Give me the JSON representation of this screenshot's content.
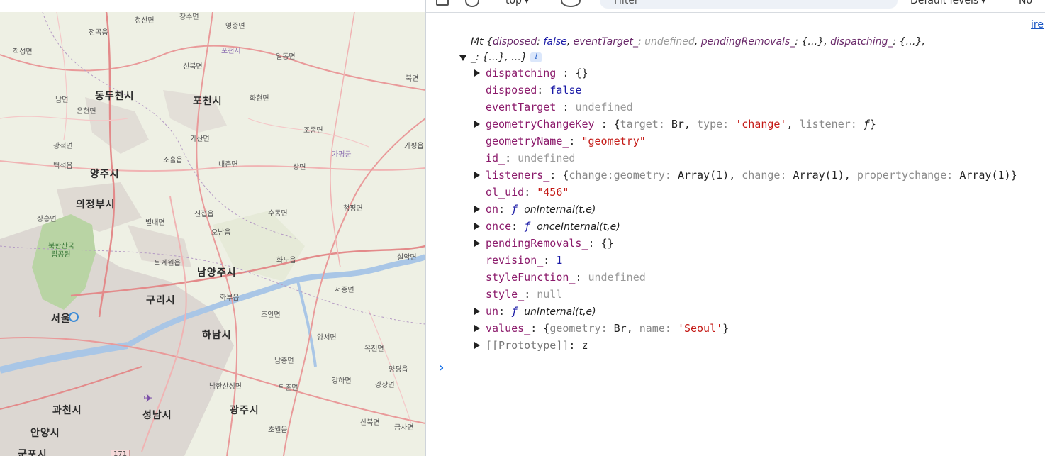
{
  "toolbar": {
    "context": "top",
    "filter_placeholder": "Filter",
    "levels": "Default levels",
    "issues": "No",
    "icons": [
      "sidebar-icon",
      "clear-console-icon",
      "eye-icon",
      "dropdown-chevron-icon"
    ]
  },
  "source_link": "ire",
  "map": {
    "marker_color": "#3b8ad6",
    "places_large": [
      "동두천시",
      "포천시",
      "양주시",
      "의정부시",
      "남양주시",
      "구리시",
      "서울",
      "하남시",
      "성남시",
      "광주시",
      "과천시",
      "안양시",
      "군포시"
    ],
    "places_mid": [
      "가평군",
      "북한산국립공원"
    ],
    "places_small": [
      "청산면",
      "창수면",
      "영중면",
      "전곡읍",
      "적성면",
      "포천시",
      "일동면",
      "신북면",
      "북면",
      "남면",
      "화현면",
      "은현면",
      "조종면",
      "광적면",
      "가산면",
      "가평읍",
      "소흘읍",
      "내촌면",
      "백석읍",
      "상면",
      "장흥면",
      "진접읍",
      "청평면",
      "별내면",
      "오남읍",
      "수동면",
      "퇴계원읍",
      "화도읍",
      "설악면",
      "서종면",
      "화부읍",
      "조안면",
      "양서면",
      "옥천면",
      "남종면",
      "양평읍",
      "남한산성면",
      "퇴촌면",
      "강하면",
      "강상면",
      "초월읍",
      "산북면",
      "금사면"
    ],
    "park_lines": [
      "북한산국",
      "립공원"
    ],
    "road_shield": "171",
    "icons": [
      "airport-icon"
    ]
  },
  "console": {
    "summary": {
      "class_name": "Mt",
      "line1_items": [
        {
          "key": "disposed",
          "value": "false",
          "kind": "bool"
        },
        {
          "key": "eventTarget_",
          "value": "undefined",
          "kind": "undef"
        },
        {
          "key": "pendingRemovals_",
          "value": "{…}",
          "kind": "plain"
        },
        {
          "key": "dispatching_",
          "value": "{…}",
          "kind": "plain"
        }
      ],
      "line2_text": "_: {…}, …}"
    },
    "properties": [
      {
        "key": "dispatching_",
        "value": "{}",
        "expandable": true
      },
      {
        "key": "disposed",
        "value": "false",
        "kind": "bool",
        "expandable": false
      },
      {
        "key": "eventTarget_",
        "value": "undefined",
        "kind": "undef",
        "expandable": false
      },
      {
        "key": "geometryChangeKey_",
        "expandable": true,
        "preview": [
          {
            "k": "target",
            "v": "Br",
            "kind": "plain"
          },
          {
            "k": "type",
            "v": "'change'",
            "kind": "str"
          },
          {
            "k": "listener",
            "v": "ƒ",
            "kind": "fn"
          }
        ]
      },
      {
        "key": "geometryName_",
        "value": "\"geometry\"",
        "kind": "str",
        "expandable": false
      },
      {
        "key": "id_",
        "value": "undefined",
        "kind": "undef",
        "expandable": false
      },
      {
        "key": "listeners_",
        "expandable": true,
        "preview": [
          {
            "k": "change:geometry",
            "v": "Array(1)",
            "kind": "plain"
          },
          {
            "k": "change",
            "v": "Array(1)",
            "kind": "plain"
          },
          {
            "k": "propertychange",
            "v": "Array(1)",
            "kind": "plain"
          }
        ]
      },
      {
        "key": "ol_uid",
        "value": "\"456\"",
        "kind": "str",
        "expandable": false
      },
      {
        "key": "on",
        "fn": "onInternal(t,e)",
        "expandable": true
      },
      {
        "key": "once",
        "fn": "onceInternal(t,e)",
        "expandable": true
      },
      {
        "key": "pendingRemovals_",
        "value": "{}",
        "expandable": true
      },
      {
        "key": "revision_",
        "value": "1",
        "kind": "num",
        "expandable": false
      },
      {
        "key": "styleFunction_",
        "value": "undefined",
        "kind": "undef",
        "expandable": false
      },
      {
        "key": "style_",
        "value": "null",
        "kind": "undef",
        "expandable": false
      },
      {
        "key": "un",
        "fn": "unInternal(t,e)",
        "expandable": true
      },
      {
        "key": "values_",
        "expandable": true,
        "preview": [
          {
            "k": "geometry",
            "v": "Br",
            "kind": "plain"
          },
          {
            "k": "name",
            "v": "'Seoul'",
            "kind": "str"
          }
        ]
      },
      {
        "key": "[[Prototype]]",
        "value": "z",
        "proto": true,
        "expandable": true
      }
    ]
  }
}
